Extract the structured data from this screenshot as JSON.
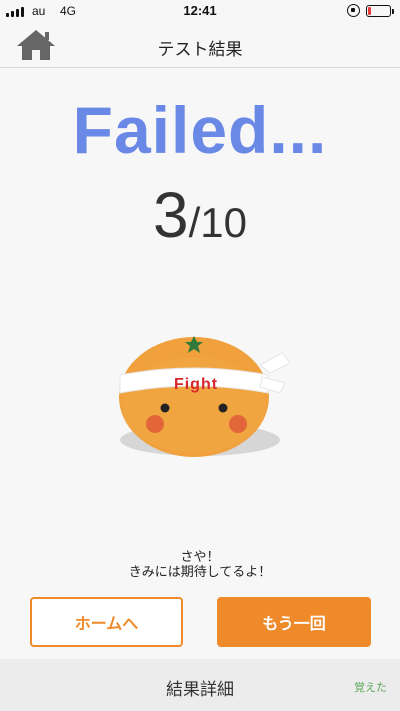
{
  "status_bar": {
    "carrier": "au",
    "network": "4G",
    "time": "12:41"
  },
  "nav": {
    "title": "テスト結果",
    "home_icon": "home-icon"
  },
  "result": {
    "status": "Failed...",
    "score": "3",
    "slash": "/",
    "total": "10"
  },
  "mascot": {
    "headband_text": "Fight"
  },
  "message": {
    "line1": "さや！",
    "line2": "きみには期待してるよ！"
  },
  "buttons": {
    "home_label": "ホームへ",
    "retry_label": "もう一回"
  },
  "footer": {
    "detail_label": "結果詳細",
    "learned_label": "覚えた"
  },
  "colors": {
    "accent_orange": "#ef8a2a",
    "failed_blue": "#6a88e6",
    "learned_green": "#5aa85a"
  }
}
